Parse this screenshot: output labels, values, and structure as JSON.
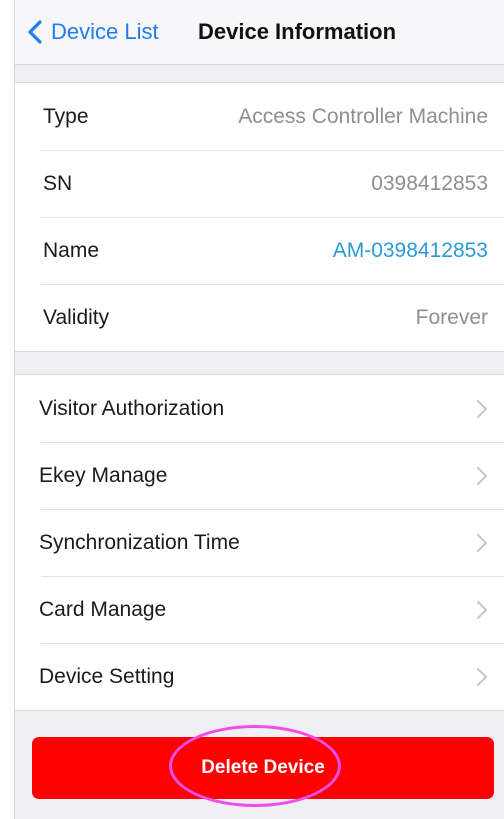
{
  "nav": {
    "back_label": "Device List",
    "title": "Device Information"
  },
  "info": [
    {
      "label": "Type",
      "value": "Access Controller Machine"
    },
    {
      "label": "SN",
      "value": "0398412853"
    },
    {
      "label": "Name",
      "value": "AM-0398412853"
    },
    {
      "label": "Validity",
      "value": "Forever"
    }
  ],
  "menu": [
    {
      "label": "Visitor Authorization"
    },
    {
      "label": "Ekey Manage"
    },
    {
      "label": "Synchronization Time"
    },
    {
      "label": "Card Manage"
    },
    {
      "label": "Device Setting"
    }
  ],
  "delete_button": {
    "label": "Delete Device"
  },
  "colors": {
    "accent": "#1f7cf0",
    "link_value": "#2a9bd8",
    "danger": "#ff0000",
    "highlight": "#ef4fe6",
    "background": "#efeff4"
  },
  "icons": {
    "back": "chevron-left-icon",
    "disclosure": "chevron-right-icon"
  }
}
